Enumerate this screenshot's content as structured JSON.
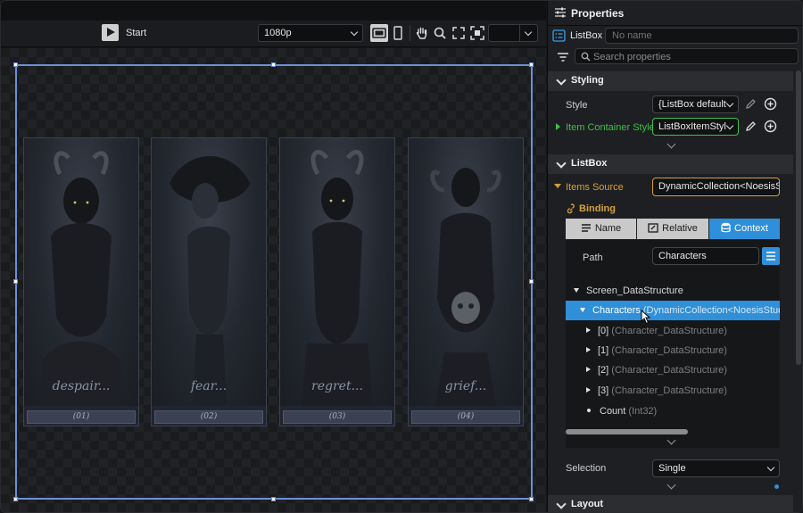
{
  "toolbar": {
    "start_label": "Start",
    "resolution": "1080p",
    "blank_dropdown": ""
  },
  "cards": [
    {
      "word": "despair...",
      "number": "(01)"
    },
    {
      "word": "fear...",
      "number": "(02)"
    },
    {
      "word": "regret...",
      "number": "(03)"
    },
    {
      "word": "grief...",
      "number": "(04)"
    }
  ],
  "properties": {
    "title": "Properties",
    "element_type": "ListBox",
    "name_placeholder": "No name",
    "search_placeholder": "Search properties",
    "styling": {
      "header": "Styling",
      "style_label": "Style",
      "style_value": "{ListBox default",
      "item_container_label": "Item Container Style",
      "item_container_value": "ListBoxItemStyl"
    },
    "listbox": {
      "header": "ListBox",
      "items_source_label": "Items Source",
      "items_source_value": "DynamicCollection<NoesisSt",
      "binding_label": "Binding",
      "tabs": [
        "Name",
        "Relative",
        "Context"
      ],
      "path_label": "Path",
      "path_value": "Characters",
      "tree": {
        "root": "Screen_DataStructure",
        "selected": "Characters",
        "selected_type": "(DynamicCollection<NoesisStudio",
        "items": [
          {
            "label": "[0]",
            "type": "(Character_DataStructure)"
          },
          {
            "label": "[1]",
            "type": "(Character_DataStructure)"
          },
          {
            "label": "[2]",
            "type": "(Character_DataStructure)"
          },
          {
            "label": "[3]",
            "type": "(Character_DataStructure)"
          }
        ],
        "count_label": "Count",
        "count_type": "(Int32)"
      },
      "selection_label": "Selection",
      "selection_value": "Single"
    },
    "layout": {
      "header": "Layout"
    }
  },
  "colors": {
    "accent": "#2f8fd8",
    "highlight_green": "#3fbf4a",
    "highlight_orange": "#d4a23a",
    "selection_blue": "#6d8fd6"
  }
}
